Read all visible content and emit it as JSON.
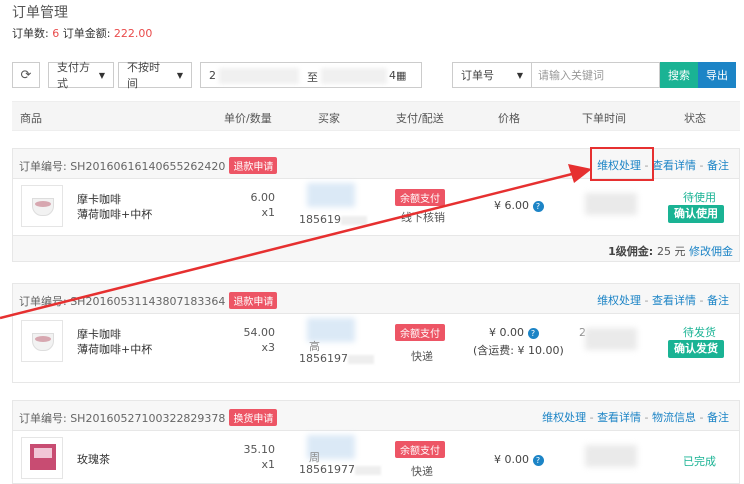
{
  "page": {
    "title": "订单管理"
  },
  "summary": {
    "count_label": "订单数: ",
    "count": "6",
    "amount_label": " 订单金额: ",
    "amount": "222.00"
  },
  "filters": {
    "refresh_icon": "refresh-icon",
    "payment_method": "支付方式",
    "time_filter": "不按时间",
    "date_start": "2",
    "date_sep": "至",
    "date_end": "4",
    "calendar_icon": "calendar-icon",
    "search_field": "订单号",
    "search_placeholder": "请输入关键词",
    "search_button": "搜索",
    "export_button": "导出"
  },
  "columns": {
    "product": "商品",
    "price_qty": "单价/数量",
    "buyer": "买家",
    "pay_ship": "支付/配送",
    "price": "价格",
    "order_time": "下单时间",
    "status": "状态"
  },
  "orders": [
    {
      "no_label": "订单编号: ",
      "no": "SH20160616140655262420",
      "badge": "退款申请",
      "actions": [
        "维权处理",
        "查看详情",
        "备注"
      ],
      "product_line1": "摩卡咖啡",
      "product_line2": "薄荷咖啡+中杯",
      "unit_price": "6.00",
      "qty": "x1",
      "buyer_phone": "185619",
      "pay_tag": "余额支付",
      "shipping": "线下核销",
      "price": "¥ 6.00",
      "status": "待使用",
      "action_button": "确认使用",
      "commission_label": "1级佣金: ",
      "commission": "25 元",
      "commission_edit": "修改佣金"
    },
    {
      "no_label": "订单编号: ",
      "no": "SH20160531143807183364",
      "badge": "退款申请",
      "actions": [
        "维权处理",
        "查看详情",
        "备注"
      ],
      "product_line1": "摩卡咖啡",
      "product_line2": "薄荷咖啡+中杯",
      "unit_price": "54.00",
      "qty": "x3",
      "buyer_name": "高",
      "buyer_phone": "1856197",
      "pay_tag": "余额支付",
      "shipping": "快递",
      "price": "¥ 0.00",
      "price_note": "(含运费: ¥ 10.00)",
      "order_time_partial": "2",
      "status": "待发货",
      "action_button": "确认发货"
    },
    {
      "no_label": "订单编号: ",
      "no": "SH20160527100322829378",
      "badge": "换货申请",
      "actions": [
        "维权处理",
        "查看详情",
        "物流信息",
        "备注"
      ],
      "product_line1": "玫瑰茶",
      "unit_price": "35.10",
      "qty": "x1",
      "buyer_name": "周",
      "buyer_phone": "18561977",
      "pay_tag": "余额支付",
      "shipping": "快递",
      "price": "¥ 0.00",
      "status": "已完成"
    }
  ],
  "colors": {
    "accent_green": "#1ab394",
    "accent_blue": "#1c84c6",
    "badge_red": "#ed5565",
    "annotation_red": "#e63030"
  }
}
